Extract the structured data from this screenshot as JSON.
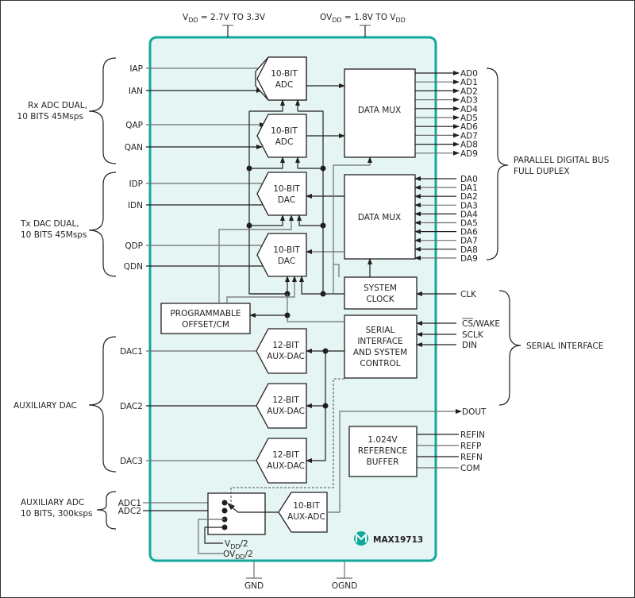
{
  "supplies": {
    "vdd": {
      "main": "V",
      "sub": "DD",
      "rest": " = 2.7V TO 3.3V"
    },
    "ovdd": {
      "pre": "OV",
      "sub": "DD",
      "mid": " = 1.8V TO V",
      "sub2": "DD"
    }
  },
  "grounds": {
    "gnd": "GND",
    "ognd": "OGND"
  },
  "groups": {
    "rx": [
      "Rx ADC DUAL,",
      "10 BITS 45Msps"
    ],
    "tx": [
      "Tx DAC DUAL,",
      "10 BITS 45Msps"
    ],
    "auxdac": [
      "AUXILIARY DAC"
    ],
    "auxadc": [
      "AUXILIARY ADC",
      "10 BITS, 300ksps"
    ],
    "parallel": [
      "PARALLEL DIGITAL BUS",
      "FULL DUPLEX"
    ],
    "serial": [
      "SERIAL INTERFACE"
    ]
  },
  "pins_left": {
    "rx": [
      "IAP",
      "IAN",
      "QAP",
      "QAN"
    ],
    "tx": [
      "IDP",
      "IDN",
      "QDP",
      "QDN"
    ],
    "auxdac": [
      "DAC1",
      "DAC2",
      "DAC3"
    ],
    "auxadc": [
      "ADC1",
      "ADC2"
    ]
  },
  "pins_right": {
    "ad": [
      "AD0",
      "AD1",
      "AD2",
      "AD3",
      "AD4",
      "AD5",
      "AD6",
      "AD7",
      "AD8",
      "AD9"
    ],
    "da": [
      "DA0",
      "DA1",
      "DA2",
      "DA3",
      "DA4",
      "DA5",
      "DA6",
      "DA7",
      "DA8",
      "DA9"
    ],
    "clk": "CLK",
    "serial": {
      "cs": "CS",
      "cs_rest": "/WAKE",
      "sclk": "SCLK",
      "din": "DIN",
      "dout": "DOUT"
    },
    "ref": [
      "REFIN",
      "REFP",
      "REFN",
      "COM"
    ]
  },
  "blocks": {
    "adc": [
      "10-BIT",
      "ADC"
    ],
    "dac": [
      "10-BIT",
      "DAC"
    ],
    "datamux": "DATA MUX",
    "sysclk": [
      "SYSTEM",
      "CLOCK"
    ],
    "prog": [
      "PROGRAMMABLE",
      "OFFSET/CM"
    ],
    "serial": [
      "SERIAL",
      "INTERFACE",
      "AND SYSTEM",
      "CONTROL"
    ],
    "auxdac": [
      "12-BIT",
      "AUX-DAC"
    ],
    "refbuf": [
      "1.024V",
      "REFERENCE",
      "BUFFER"
    ],
    "auxadc": [
      "10-BIT",
      "AUX-ADC"
    ]
  },
  "mux_inputs": {
    "vdd2": {
      "pre": "V",
      "sub": "DD",
      "post": "/2"
    },
    "ovdd2": {
      "pre": "OV",
      "sub": "DD",
      "post": "/2"
    }
  },
  "chip": {
    "name": "MAX19713",
    "logo": "maxim-logo-icon"
  },
  "colors": {
    "chip_fill": "#e4f5f4",
    "chip_border": "#12a99b",
    "ink": "#231f20"
  }
}
